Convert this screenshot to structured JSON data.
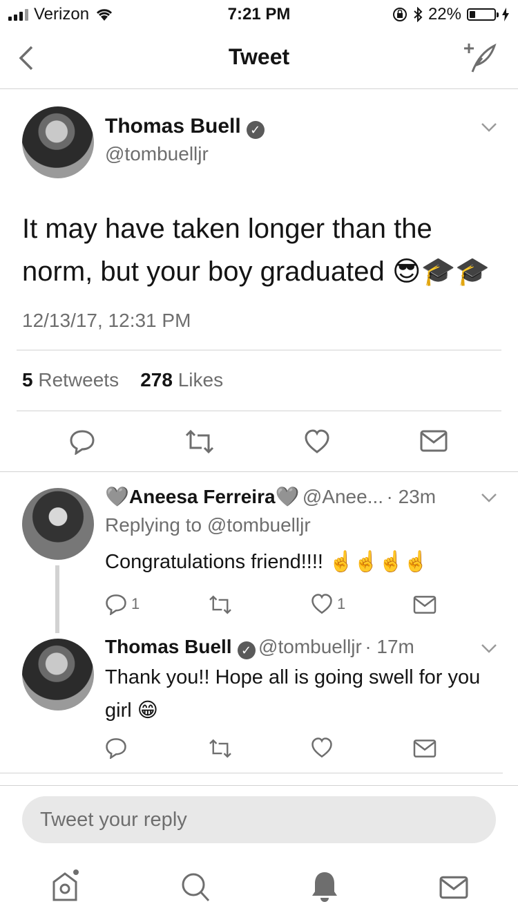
{
  "status_bar": {
    "carrier": "Verizon",
    "time": "7:21 PM",
    "battery": "22%",
    "battery_level": 0.22
  },
  "nav": {
    "title": "Tweet",
    "back_icon": "chevron-left-icon",
    "compose_icon": "compose-tweet-icon"
  },
  "main_tweet": {
    "name": "Thomas Buell",
    "handle": "@tombuelljr",
    "text": "It may have taken longer than the norm, but your boy graduated 😎🎓🎓",
    "timestamp": "12/13/17, 12:31 PM",
    "retweets_count": "5",
    "retweets_label": "Retweets",
    "likes_count": "278",
    "likes_label": "Likes"
  },
  "replies": [
    {
      "name": "🩶Aneesa Ferreira🩶",
      "handle": "@Anee...",
      "time": "· 23m",
      "replying_to": "Replying to @tombuelljr",
      "text": "Congratulations friend!!!! ☝️☝️☝️☝️",
      "reply_count": "1",
      "like_count": "1"
    },
    {
      "name": "Thomas Buell",
      "handle": "@tombuelljr",
      "time": "· 17m",
      "text": "Thank you!! Hope all is going swell for you girl 😁"
    }
  ],
  "reply_input": {
    "placeholder": "Tweet your reply"
  },
  "tab_bar": [
    "home-icon",
    "search-icon",
    "notifications-icon",
    "messages-icon"
  ]
}
